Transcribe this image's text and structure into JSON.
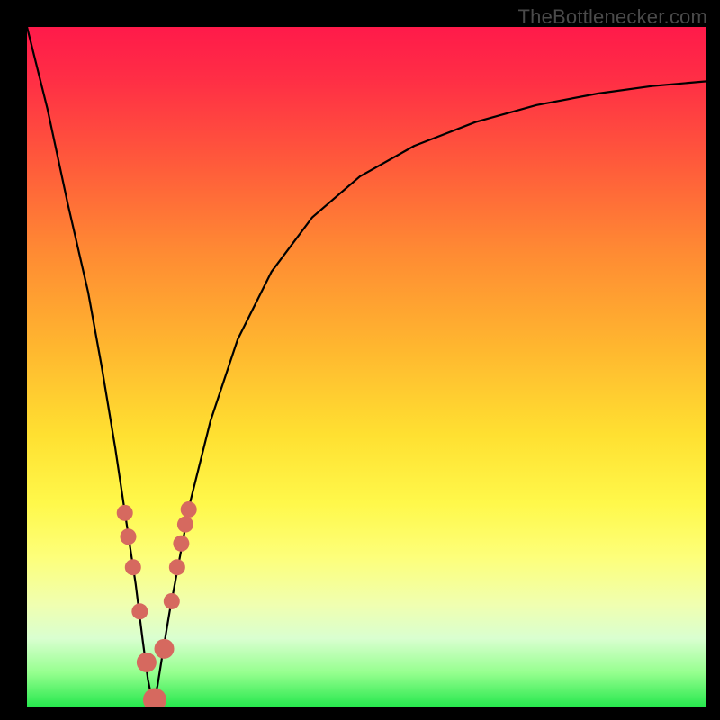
{
  "watermark": "TheBottlenecker.com",
  "colors": {
    "page_bg": "#000000",
    "gradient_top": "#ff1a4a",
    "gradient_bottom": "#27e84e",
    "curve_stroke": "#000000",
    "marker_fill": "#d6695f"
  },
  "chart_data": {
    "type": "line",
    "title": "",
    "xlabel": "",
    "ylabel": "",
    "xlim": [
      0,
      100
    ],
    "ylim": [
      0,
      100
    ],
    "grid": false,
    "x_minimum": 18.5,
    "series": [
      {
        "name": "bottleneck-curve",
        "x": [
          0,
          3,
          6,
          9,
          11,
          13,
          14.5,
          16,
          17,
          17.8,
          18.5,
          19.2,
          20,
          21,
          22.5,
          24,
          27,
          31,
          36,
          42,
          49,
          57,
          66,
          75,
          84,
          92,
          100
        ],
        "values": [
          100,
          88,
          74,
          61,
          50,
          38,
          28,
          18,
          10,
          4,
          0.5,
          3,
          8,
          14,
          22,
          30,
          42,
          54,
          64,
          72,
          78,
          82.5,
          86,
          88.5,
          90.2,
          91.3,
          92
        ]
      }
    ],
    "markers": {
      "name": "highlighted-points",
      "x": [
        14.4,
        14.9,
        15.6,
        16.6,
        17.6,
        18.8,
        20.2,
        21.3,
        22.1,
        22.7,
        23.3,
        23.8
      ],
      "values": [
        28.5,
        25.0,
        20.5,
        14.0,
        6.5,
        1.0,
        8.5,
        15.5,
        20.5,
        24.0,
        26.8,
        29.0
      ],
      "r": [
        9,
        9,
        9,
        9,
        11,
        13,
        11,
        9,
        9,
        9,
        9,
        9
      ]
    }
  }
}
